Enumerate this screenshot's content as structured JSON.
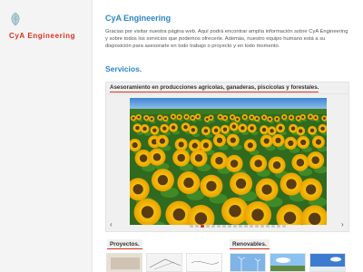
{
  "sidebar": {
    "logo_icon": "leaf-logo-icon",
    "brand": "CyA Engineering"
  },
  "main": {
    "title": "CyA Engineering",
    "intro": "Gracias por visitar nuestra página web. Aquí podrá encontrar amplia información sobre CyA Engineering y sobre todos los servicios que podemos ofrecerle. Además, nuestro equipo humano está a su disposición para asesorarle en todo trabajo o proyecto y en todo momento.",
    "services_heading": "Servicios.",
    "card": {
      "caption": "Asesoramiento en producciones agrícolas, ganaderas, piscícolas y forestales.",
      "image": "sunflower-field-photo",
      "prev_icon": "chevron-left-icon",
      "next_icon": "chevron-right-icon",
      "prev_glyph": "‹",
      "next_glyph": "›",
      "slide_count": 18,
      "active_slide": 2
    },
    "sections": {
      "projects": "Proyectos.",
      "renewables": "Renovables."
    }
  },
  "colors": {
    "brand_red": "#d9311c",
    "accent_blue": "#2a86c6"
  }
}
